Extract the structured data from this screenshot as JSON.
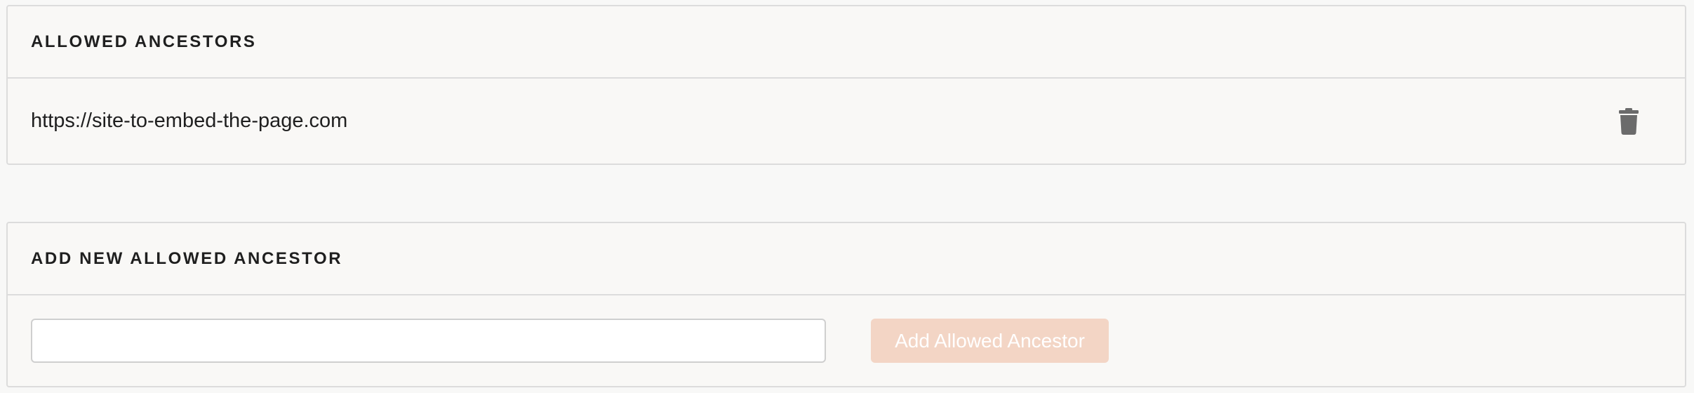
{
  "allowed_ancestors": {
    "title": "ALLOWED ANCESTORS",
    "items": [
      {
        "url": "https://site-to-embed-the-page.com",
        "delete_icon": "trash-icon"
      }
    ]
  },
  "add_new": {
    "title": "ADD NEW ALLOWED ANCESTOR",
    "input_value": "",
    "input_placeholder": "",
    "button_label": "Add Allowed Ancestor",
    "button_disabled": true
  },
  "colors": {
    "background": "#f8f8f7",
    "panel_border": "#dcdcdc",
    "button_disabled_bg": "#f3d5c5",
    "icon": "#6b6b6b"
  }
}
